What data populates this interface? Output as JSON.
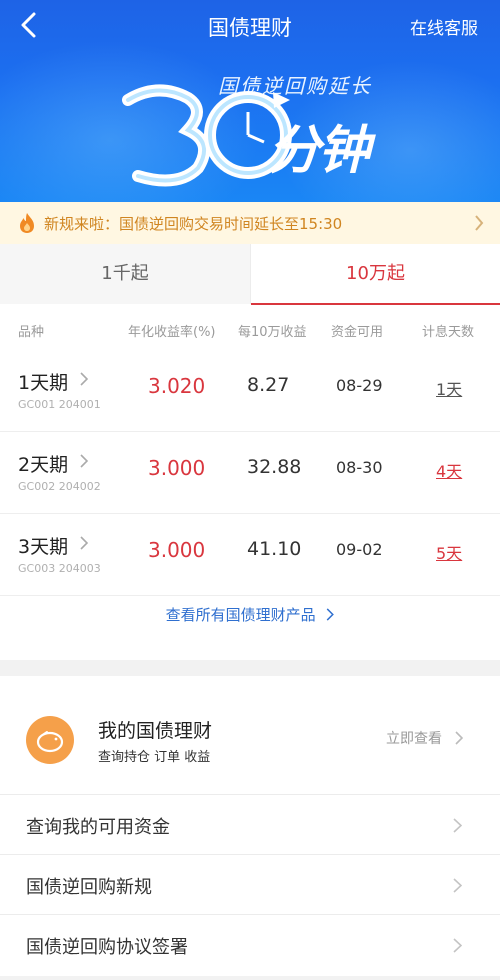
{
  "header": {
    "title": "国债理财",
    "customer_service": "在线客服"
  },
  "banner": {
    "subtitle": "国债逆回购延长",
    "big_number": "30",
    "unit": "分钟"
  },
  "notice": {
    "text": "新规来啦：国债逆回购交易时间延长至15:30"
  },
  "tabs": [
    {
      "label": "1千起",
      "active": false
    },
    {
      "label": "10万起",
      "active": true
    }
  ],
  "table": {
    "headers": [
      "品种",
      "年化收益率(%)",
      "每10万收益",
      "资金可用",
      "计息天数"
    ],
    "rows": [
      {
        "name": "1天期",
        "code": "GC001 204001",
        "rate": "3.020",
        "earning": "8.27",
        "available": "08-29",
        "days": "1天",
        "days_color": "#555555"
      },
      {
        "name": "2天期",
        "code": "GC002 204002",
        "rate": "3.000",
        "earning": "32.88",
        "available": "08-30",
        "days": "4天",
        "days_color": "#d9363e"
      },
      {
        "name": "3天期",
        "code": "GC003 204003",
        "rate": "3.000",
        "earning": "41.10",
        "available": "09-02",
        "days": "5天",
        "days_color": "#d9363e"
      }
    ],
    "view_all": "查看所有国债理财产品"
  },
  "my": {
    "title": "我的国债理财",
    "subtitle": "查询持仓 订单 收益",
    "view_now": "立即查看"
  },
  "menu": [
    {
      "label": "查询我的可用资金"
    },
    {
      "label": "国债逆回购新规"
    },
    {
      "label": "国债逆回购协议签署"
    }
  ]
}
